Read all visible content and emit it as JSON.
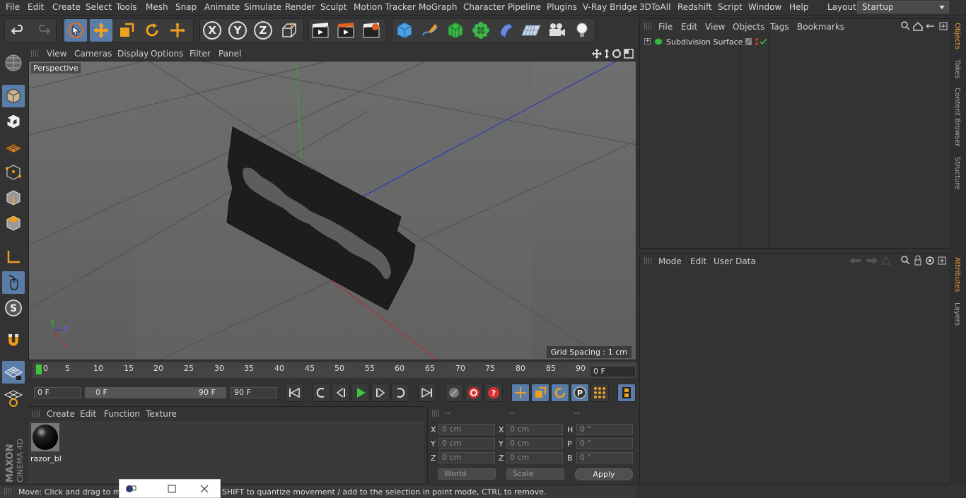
{
  "menu": [
    "File",
    "Edit",
    "Create",
    "Select",
    "Tools",
    "Mesh",
    "Snap",
    "Animate",
    "Simulate",
    "Render",
    "Sculpt",
    "Motion Tracker",
    "MoGraph",
    "Character",
    "Pipeline",
    "Plugins",
    "V-Ray Bridge",
    "3DToAll",
    "Redshift",
    "Script",
    "Window",
    "Help"
  ],
  "layout": {
    "label": "Layout:",
    "value": "Startup"
  },
  "viewport": {
    "menu": [
      "View",
      "Cameras",
      "Display",
      "Options",
      "Filter",
      "Panel"
    ],
    "label": "Perspective",
    "grid_spacing": "Grid Spacing : 1 cm"
  },
  "timeline": {
    "ticks": [
      "0",
      "5",
      "10",
      "15",
      "20",
      "25",
      "30",
      "35",
      "40",
      "45",
      "50",
      "55",
      "60",
      "65",
      "70",
      "75",
      "80",
      "85",
      "90"
    ],
    "current_frame": "0 F",
    "start_field": "0 F",
    "range_start": "0 F",
    "range_end": "90 F",
    "end_field": "90 F"
  },
  "material_manager": {
    "menu": [
      "Create",
      "Edit",
      "Function",
      "Texture"
    ],
    "materials": [
      {
        "name": "razor_bl"
      }
    ]
  },
  "coordinates": {
    "headers": [
      "--",
      "--",
      "--"
    ],
    "rows": [
      {
        "l1": "X",
        "v1": "0 cm",
        "l2": "X",
        "v2": "0 cm",
        "l3": "H",
        "v3": "0 °"
      },
      {
        "l1": "Y",
        "v1": "0 cm",
        "l2": "Y",
        "v2": "0 cm",
        "l3": "P",
        "v3": "0 °"
      },
      {
        "l1": "Z",
        "v1": "0 cm",
        "l2": "Z",
        "v2": "0 cm",
        "l3": "B",
        "v3": "0 °"
      }
    ],
    "space": "World",
    "mode": "Scale",
    "apply": "Apply"
  },
  "object_manager": {
    "menu": [
      "File",
      "Edit",
      "View",
      "Objects",
      "Tags",
      "Bookmarks"
    ],
    "objects": [
      {
        "name": "Subdivision Surface"
      }
    ]
  },
  "attribute_manager": {
    "menu": [
      "Mode",
      "Edit",
      "User Data"
    ]
  },
  "right_tabs": [
    "Objects",
    "Takes",
    "Content Browser",
    "Structure"
  ],
  "right_tabs_lower": [
    "Attributes",
    "Layers"
  ],
  "status": "Move: Click and drag to move elements. Hold down SHIFT to quantize movement / add to the selection in point mode, CTRL to remove.",
  "branding": {
    "line1": "MAXON",
    "line2": "CINEMA 4D"
  },
  "colors": {
    "accent": "#5a7ca8",
    "active_tab": "#e9a23b",
    "play_green": "#3ec43e",
    "red": "#d83030"
  }
}
